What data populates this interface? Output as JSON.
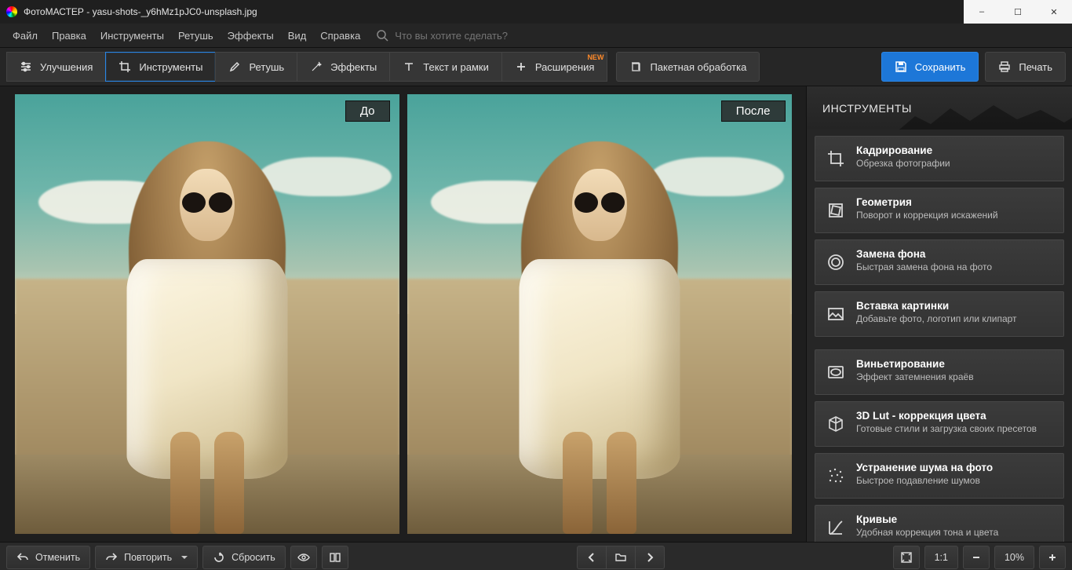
{
  "window": {
    "title": "ФотоМАСТЕР - yasu-shots-_y6hMz1pJC0-unsplash.jpg"
  },
  "menubar": {
    "file": "Файл",
    "edit": "Правка",
    "tools": "Инструменты",
    "retouch": "Ретушь",
    "effects": "Эффекты",
    "view": "Вид",
    "help": "Справка",
    "search_placeholder": "Что вы хотите сделать?"
  },
  "toolbar": {
    "enhance": "Улучшения",
    "tools": "Инструменты",
    "retouch": "Ретушь",
    "effects": "Эффекты",
    "text": "Текст и рамки",
    "extensions": "Расширения",
    "extensions_badge": "NEW",
    "batch": "Пакетная обработка",
    "save": "Сохранить",
    "print": "Печать"
  },
  "viewer": {
    "before": "До",
    "after": "После"
  },
  "sidepanel": {
    "header": "ИНСТРУМЕНТЫ",
    "g1": [
      {
        "title": "Кадрирование",
        "sub": "Обрезка фотографии"
      },
      {
        "title": "Геометрия",
        "sub": "Поворот и коррекция искажений"
      },
      {
        "title": "Замена фона",
        "sub": "Быстрая замена фона на фото"
      },
      {
        "title": "Вставка картинки",
        "sub": "Добавьте фото, логотип или клипарт"
      }
    ],
    "g2": [
      {
        "title": "Виньетирование",
        "sub": "Эффект затемнения краёв"
      },
      {
        "title": "3D Lut - коррекция цвета",
        "sub": "Готовые стили и загрузка своих пресетов"
      },
      {
        "title": "Устранение шума на фото",
        "sub": "Быстрое подавление шумов"
      },
      {
        "title": "Кривые",
        "sub": "Удобная коррекция тона и цвета"
      }
    ]
  },
  "bottombar": {
    "undo": "Отменить",
    "redo": "Повторить",
    "reset": "Сбросить",
    "scale_label": "1:1",
    "zoom": "10%"
  }
}
